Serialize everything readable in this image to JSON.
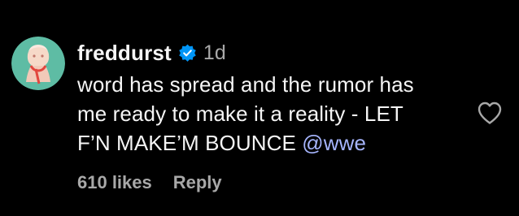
{
  "comment": {
    "username": "freddurst",
    "verified": true,
    "time_ago": "1d",
    "text_lines": [
      "word has spread and the rumor has",
      "me ready to make it a reality - LET",
      "F’N MAKE’M BOUNCE "
    ],
    "mention": "@wwe",
    "likes_label": "610 likes",
    "reply_label": "Reply"
  },
  "icons": {
    "avatar": "avatar",
    "verified": "verified-badge-icon",
    "like": "heart-outline-icon"
  },
  "colors": {
    "background": "#000000",
    "text_primary": "#f5f5f5",
    "text_secondary": "#a8a8a8",
    "mention": "#a5b4fc",
    "verified_badge": "#0095f6",
    "avatar_bg": "#5ebca4"
  }
}
